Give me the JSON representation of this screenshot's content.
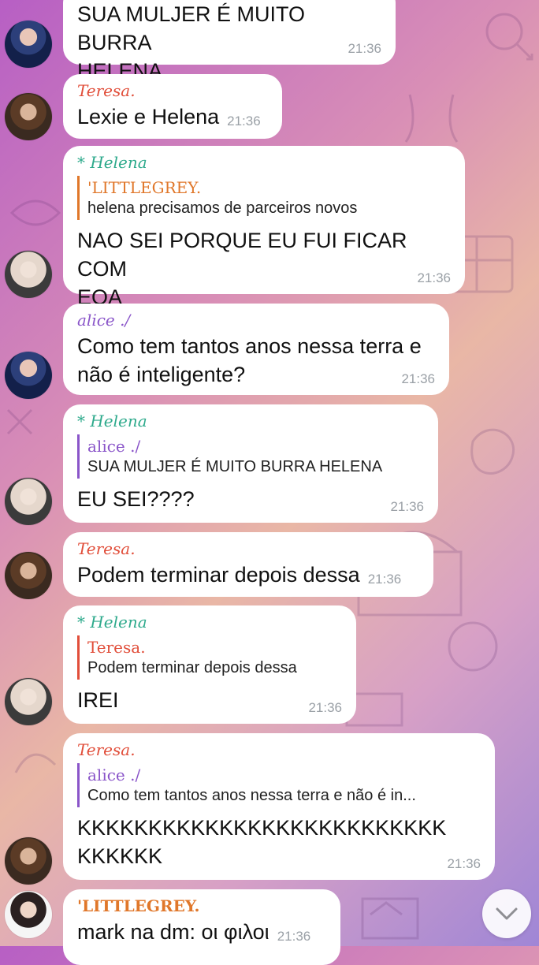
{
  "messages": [
    {
      "sender": "",
      "text": "SUA MULJER É MUITO BURRA\nHELENA",
      "time": "21:36"
    },
    {
      "sender": "Teresa.",
      "text": "Lexie e Helena",
      "time": "21:36"
    },
    {
      "sender": "* Helena",
      "reply_name": "'LITTLEGREY.",
      "reply_text": "helena precisamos de parceiros novos",
      "text": "NAO SEI PORQUE EU FUI FICAR COM\nEOA",
      "time": "21:36"
    },
    {
      "sender": "alice ./",
      "text": "Como tem tantos anos nessa terra e\nnão é inteligente?",
      "time": "21:36"
    },
    {
      "sender": "* Helena",
      "reply_name": "alice ./",
      "reply_text": "SUA MULJER É MUITO BURRA HELENA",
      "text": "EU SEI????",
      "time": "21:36"
    },
    {
      "sender": "Teresa.",
      "text": "Podem terminar depois dessa",
      "time": "21:36"
    },
    {
      "sender": "* Helena",
      "reply_name": "Teresa.",
      "reply_text": "Podem terminar depois dessa",
      "text": "IREI",
      "time": "21:36"
    },
    {
      "sender": "Teresa.",
      "reply_name": "alice ./",
      "reply_text": "Como tem tantos anos nessa terra e não é in...",
      "text": "KKKKKKKKKKKKKKKKKKKKKKKKKK\nKKKKKK",
      "time": "21:36"
    },
    {
      "sender": "'LITTLEGREY.",
      "text": "mark na dm: οι φιλοι",
      "time": "21:36"
    }
  ],
  "colors": {
    "teresa": "#e14e3a",
    "helena": "#2eaa8c",
    "alice": "#8a55c9",
    "littlegrey": "#e0772a",
    "bubble": "#ffffff",
    "time": "#9aa0a6"
  },
  "icons": {
    "scroll_down": "chevron-down-icon"
  }
}
